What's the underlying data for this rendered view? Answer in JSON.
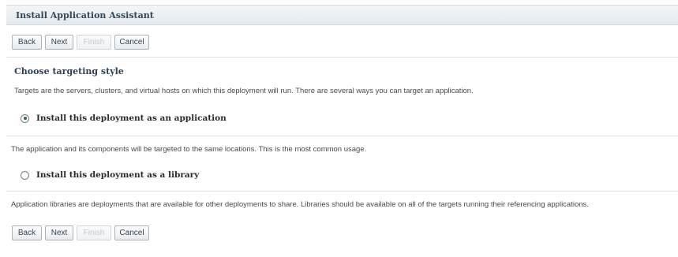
{
  "window": {
    "title": "Install Application Assistant"
  },
  "buttons": {
    "back": "Back",
    "next": "Next",
    "finish": "Finish",
    "cancel": "Cancel"
  },
  "section": {
    "title": "Choose targeting style",
    "description": "Targets are the servers, clusters, and virtual hosts on which this deployment will run. There are several ways you can target an application."
  },
  "options": [
    {
      "label": "Install this deployment as an application",
      "selected": true,
      "description": "The application and its components will be targeted to the same locations. This is the most common usage."
    },
    {
      "label": "Install this deployment as a library",
      "selected": false,
      "description": "Application libraries are deployments that are available for other deployments to share. Libraries should be available on all of the targets running their referencing applications."
    }
  ],
  "colors": {
    "title_bar": "#e4e9ee",
    "title_text": "#30475c",
    "button_border": "#a8b2bb",
    "disabled_text": "#c4c9ce"
  }
}
